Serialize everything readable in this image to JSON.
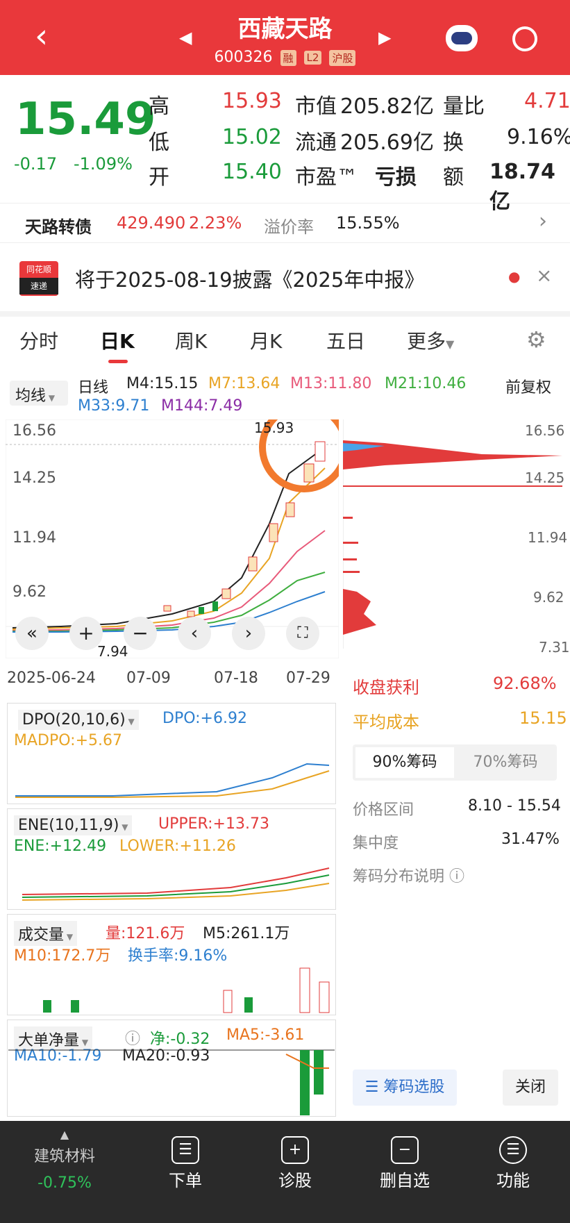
{
  "header": {
    "title": "西藏天路",
    "code": "600326",
    "tags": [
      "融",
      "L2",
      "沪股"
    ]
  },
  "quote": {
    "price": "15.49",
    "change": "-0.17",
    "change_pct": "-1.09%",
    "high_label": "高",
    "high": "15.93",
    "low_label": "低",
    "low": "15.02",
    "open_label": "开",
    "open": "15.40",
    "mcap_label": "市值",
    "mcap": "205.82亿",
    "float_label": "流通",
    "float": "205.69亿",
    "pe_label": "市盈™",
    "pe": "亏损",
    "vr_label": "量比",
    "vr": "4.71",
    "turn_label": "换",
    "turn": "9.16%",
    "amt_label": "额",
    "amt": "18.74亿"
  },
  "bond": {
    "name": "天路转债",
    "price": "429.490",
    "pct": "2.23%",
    "prem_label": "溢价率",
    "prem": "15.55%"
  },
  "notice": {
    "logo_top": "同花顺",
    "logo_bot": "速递",
    "text": "将于2025-08-19披露《2025年中报》"
  },
  "tabs": [
    "分时",
    "日K",
    "周K",
    "月K",
    "五日",
    "更多"
  ],
  "kline": {
    "ma_selector": "均线",
    "period": "日线",
    "m4": "M4:15.15",
    "m7": "M7:13.64",
    "m13": "M13:11.80",
    "m21": "M21:10.46",
    "m33": "M33:9.71",
    "m144": "M144:7.49",
    "adj": "前复权",
    "ylabels": [
      "16.56",
      "14.25",
      "11.94",
      "9.62"
    ],
    "high_mark": "15.93",
    "low_mark": "7.94",
    "xlabels": [
      "2025-06-24",
      "07-09",
      "07-18",
      "07-29"
    ],
    "chip_labels": [
      "16.56",
      "14.25",
      "11.94",
      "9.62",
      "7.31"
    ]
  },
  "chip": {
    "profit_label": "收盘获利",
    "profit": "92.68%",
    "cost_label": "平均成本",
    "cost": "15.15",
    "tab1": "90%筹码",
    "tab2": "70%筹码",
    "range_label": "价格区间",
    "range": "8.10 - 15.54",
    "conc_label": "集中度",
    "conc": "31.47%",
    "help": "筹码分布说明",
    "select": "筹码选股",
    "close": "关闭"
  },
  "dpo": {
    "name": "DPO(20,10,6)",
    "dpo": "DPO:+6.92",
    "madpo": "MADPO:+5.67"
  },
  "ene": {
    "name": "ENE(10,11,9)",
    "upper": "UPPER:+13.73",
    "ene": "ENE:+12.49",
    "lower": "LOWER:+11.26"
  },
  "vol": {
    "name": "成交量",
    "v": "量:121.6万",
    "m5": "M5:261.1万",
    "m10": "M10:172.7万",
    "turn": "换手率:9.16%"
  },
  "flow": {
    "name": "大单净量",
    "net": "净:-0.32",
    "ma5": "MA5:-3.61",
    "ma10": "MA10:-1.79",
    "ma20": "MA20:-0.93"
  },
  "nav": {
    "sector": "建筑材料",
    "sector_pct": "-0.75%",
    "items": [
      "下单",
      "诊股",
      "删自选",
      "功能"
    ]
  },
  "colors": {
    "red": "#e23b3b",
    "green": "#1a9b3a",
    "header": "#e9383b"
  }
}
